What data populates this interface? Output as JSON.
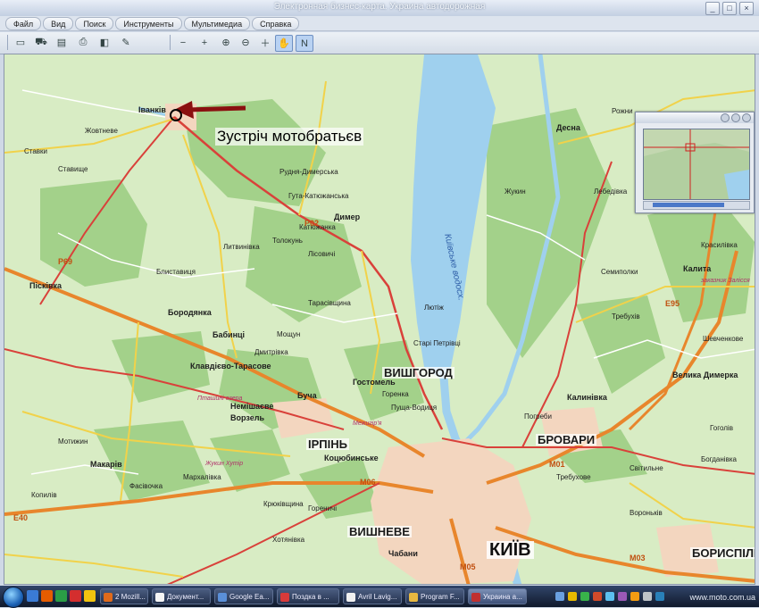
{
  "window": {
    "title": "Электронная бизнес-карта. Украина автодорожная"
  },
  "menu": [
    {
      "label": "Файл"
    },
    {
      "label": "Вид"
    },
    {
      "label": "Поиск"
    },
    {
      "label": "Инструменты"
    },
    {
      "label": "Мультимедиа"
    },
    {
      "label": "Справка"
    }
  ],
  "toolbar": {
    "tools": [
      {
        "name": "open-icon",
        "glyph": "▭"
      },
      {
        "name": "car-icon",
        "glyph": "⛟"
      },
      {
        "name": "layers-icon",
        "glyph": "▤"
      },
      {
        "name": "print-icon",
        "glyph": "⎙"
      },
      {
        "name": "eraser-icon",
        "glyph": "◧"
      },
      {
        "name": "pencil-icon",
        "glyph": "✎"
      },
      {
        "name": "zoom-out-icon",
        "glyph": "−"
      },
      {
        "name": "zoom-in-icon",
        "glyph": "+"
      },
      {
        "name": "zoom-window-icon",
        "glyph": "⊕"
      },
      {
        "name": "zoom-fit-icon",
        "glyph": "⊖"
      },
      {
        "name": "zoom-plus-icon",
        "glyph": "＋"
      },
      {
        "name": "zoom-minus-icon",
        "glyph": "－"
      },
      {
        "name": "hand-pan-icon",
        "glyph": "✋"
      },
      {
        "name": "navigation-icon",
        "glyph": "N"
      }
    ]
  },
  "map": {
    "annotation": "Зустріч мотобратьєв",
    "reservoir_label": "Київське водосх.",
    "cities": {
      "kyiv": "КИЇВ",
      "brovary": "БРОВАРИ",
      "irpin": "ІРПІНЬ",
      "vyshhorod": "ВИШГОРОД",
      "boryspil": "БОРИСПІЛЬ",
      "vyshneve": "ВИШНЕВЕ"
    },
    "towns": [
      "Іванків",
      "Десна",
      "Димер",
      "Пісківка",
      "Бородянка",
      "Бабинці",
      "Клавдієво-Тарасове",
      "Буча",
      "Гостомель",
      "Немішаєве",
      "Ворзель",
      "Коцюбинське",
      "Макарів",
      "Калинівка",
      "Калита",
      "Велика Димерка",
      "Чабани",
      "Лютіж",
      "Старі Петрівці",
      "Горенка",
      "Пуща-Водиця",
      "Погреби",
      "Лебедівка",
      "Вороньків"
    ],
    "villages": [
      "Ставки",
      "Жовтневе",
      "Ставище",
      "Рудня-Димерська",
      "Гута-Катюжанська",
      "Катюжанка",
      "Толокунь",
      "Лісовичі",
      "Литвинівка",
      "Тарасівщина",
      "Мощун",
      "Дмитрівка",
      "Блиставиця",
      "Мотижин",
      "Копилів",
      "Фасівочка",
      "Мархалівка",
      "Гореничі",
      "Крюківщина",
      "Хотянівка",
      "Рожни",
      "Шевченкове",
      "Богданівка",
      "Гоголів",
      "Требухів",
      "Семиполки",
      "Жукин",
      "Світильне",
      "Требухове",
      "Красилівка"
    ],
    "pink_labels": [
      "Жукин Хутір",
      "Пташині озера",
      "Межигір'я",
      "заказник Залісся"
    ],
    "road_numbers": [
      "М06",
      "М01",
      "М03",
      "M05",
      "Р02",
      "Р69",
      "Е95",
      "Е40"
    ]
  },
  "minimap": {
    "title": ""
  },
  "taskbar": {
    "tasks": [
      {
        "label": "2 Mozill...",
        "color": "#e06a1a"
      },
      {
        "label": "Документ...",
        "color": "#f5f5f5"
      },
      {
        "label": "Google Ea...",
        "color": "#5a8fd8"
      },
      {
        "label": "Поздка в ...",
        "color": "#d83a3a"
      },
      {
        "label": "Avril Lavig...",
        "color": "#f0f0f0"
      },
      {
        "label": "Program F...",
        "color": "#e8b840"
      },
      {
        "label": "Украина а...",
        "color": "#c03030"
      }
    ],
    "watermark": "www.moto.com.ua"
  },
  "colors": {
    "map_bg": "#d8ecc4",
    "forest": "#9fcf85",
    "water": "#9fd0ee",
    "motorway": "#e8862c",
    "arrow": "#8a1010"
  }
}
